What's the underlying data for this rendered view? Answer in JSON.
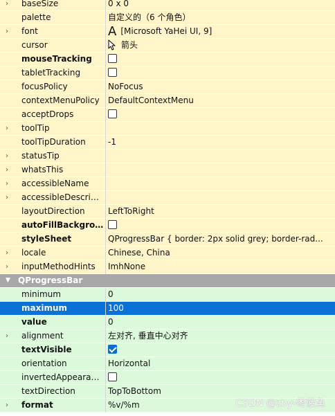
{
  "property_editor": {
    "colors": {
      "widget_rows": "#fff5c8",
      "progressbar_rows": "#dcf9dc",
      "section_header": "#a8a8a8",
      "selection": "#0a72d6",
      "checked": "#0a6ed1"
    },
    "widget_properties": [
      {
        "name": "baseSize",
        "value": "0 x 0",
        "expandable": true,
        "bold": false,
        "kind": "text"
      },
      {
        "name": "palette",
        "value": "自定义的（6 个角色）",
        "expandable": false,
        "bold": false,
        "kind": "text"
      },
      {
        "name": "font",
        "value": "[Microsoft YaHei UI, 9]",
        "icon_glyph": "A",
        "expandable": true,
        "bold": false,
        "kind": "font"
      },
      {
        "name": "cursor",
        "value": "箭头",
        "expandable": false,
        "bold": false,
        "kind": "cursor"
      },
      {
        "name": "mouseTracking",
        "value": "",
        "expandable": false,
        "bold": true,
        "kind": "checkbox",
        "checked": false
      },
      {
        "name": "tabletTracking",
        "value": "",
        "expandable": false,
        "bold": false,
        "kind": "checkbox",
        "checked": false
      },
      {
        "name": "focusPolicy",
        "value": "NoFocus",
        "expandable": false,
        "bold": false,
        "kind": "text"
      },
      {
        "name": "contextMenuPolicy",
        "value": "DefaultContextMenu",
        "expandable": false,
        "bold": false,
        "kind": "text"
      },
      {
        "name": "acceptDrops",
        "value": "",
        "expandable": false,
        "bold": false,
        "kind": "checkbox",
        "checked": false
      },
      {
        "name": "toolTip",
        "value": "",
        "expandable": true,
        "bold": false,
        "kind": "text"
      },
      {
        "name": "toolTipDuration",
        "value": "-1",
        "expandable": false,
        "bold": false,
        "kind": "text"
      },
      {
        "name": "statusTip",
        "value": "",
        "expandable": true,
        "bold": false,
        "kind": "text"
      },
      {
        "name": "whatsThis",
        "value": "",
        "expandable": true,
        "bold": false,
        "kind": "text"
      },
      {
        "name": "accessibleName",
        "value": "",
        "expandable": true,
        "bold": false,
        "kind": "text"
      },
      {
        "name": "accessibleDescript...",
        "value": "",
        "expandable": true,
        "bold": false,
        "kind": "text"
      },
      {
        "name": "layoutDirection",
        "value": "LeftToRight",
        "expandable": false,
        "bold": false,
        "kind": "text"
      },
      {
        "name": "autoFillBackgrou...",
        "value": "",
        "expandable": false,
        "bold": true,
        "kind": "checkbox",
        "checked": false
      },
      {
        "name": "styleSheet",
        "value": "QProgressBar {    border: 2px solid grey;    border-rad...",
        "expandable": false,
        "bold": true,
        "kind": "text"
      },
      {
        "name": "locale",
        "value": "Chinese, China",
        "expandable": true,
        "bold": false,
        "kind": "text"
      },
      {
        "name": "inputMethodHints",
        "value": "ImhNone",
        "expandable": true,
        "bold": false,
        "kind": "text"
      }
    ],
    "section": {
      "title": "QProgressBar",
      "collapse_glyph": "▼"
    },
    "progressbar_properties": [
      {
        "name": "minimum",
        "value": "0",
        "expandable": false,
        "bold": false,
        "kind": "text",
        "selected": false
      },
      {
        "name": "maximum",
        "value": "100",
        "expandable": false,
        "bold": true,
        "kind": "text",
        "selected": true
      },
      {
        "name": "value",
        "value": "0",
        "expandable": false,
        "bold": true,
        "kind": "text",
        "selected": false
      },
      {
        "name": "alignment",
        "value": "左对齐, 垂直中心对齐",
        "expandable": true,
        "bold": false,
        "kind": "text",
        "selected": false
      },
      {
        "name": "textVisible",
        "value": "",
        "expandable": false,
        "bold": true,
        "kind": "checkbox",
        "checked": true,
        "selected": false
      },
      {
        "name": "orientation",
        "value": "Horizontal",
        "expandable": false,
        "bold": false,
        "kind": "text",
        "selected": false
      },
      {
        "name": "invertedAppearance",
        "value": "",
        "expandable": false,
        "bold": false,
        "kind": "checkbox",
        "checked": false,
        "selected": false
      },
      {
        "name": "textDirection",
        "value": "TopToBottom",
        "expandable": false,
        "bold": false,
        "kind": "text",
        "selected": false
      },
      {
        "name": "format",
        "value": "%v/%m",
        "expandable": true,
        "bold": true,
        "kind": "text",
        "selected": false
      }
    ],
    "expand_glyph": "›"
  },
  "watermark": "CSDN @zby-枣菠鱼"
}
